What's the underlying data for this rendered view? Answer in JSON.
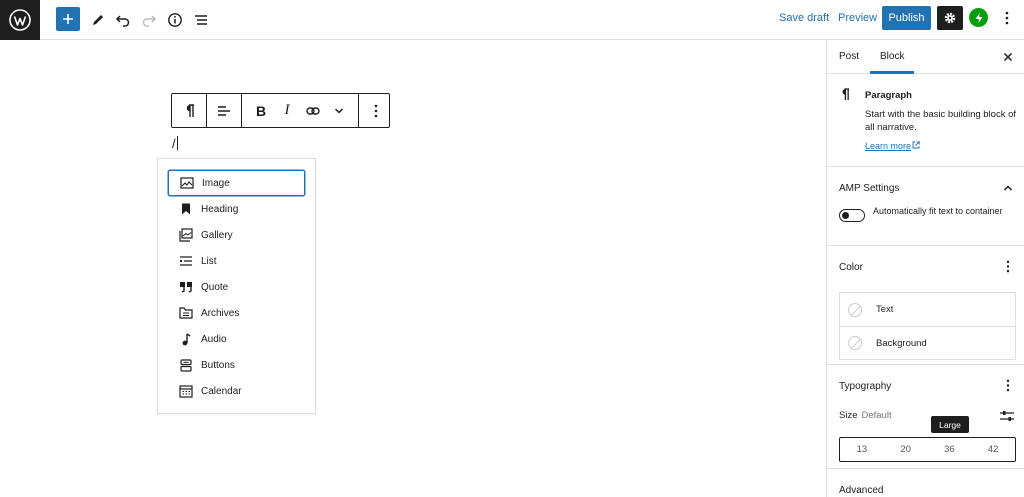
{
  "topbar": {
    "save_draft": "Save draft",
    "preview": "Preview",
    "publish": "Publish"
  },
  "block_toolbar": {
    "bold": "B",
    "italic": "I"
  },
  "editor": {
    "slash_text": "/"
  },
  "inserter_items": [
    {
      "label": "Image",
      "icon": "image-icon"
    },
    {
      "label": "Heading",
      "icon": "bookmark-icon"
    },
    {
      "label": "Gallery",
      "icon": "gallery-icon"
    },
    {
      "label": "List",
      "icon": "list-icon"
    },
    {
      "label": "Quote",
      "icon": "quote-icon"
    },
    {
      "label": "Archives",
      "icon": "archive-icon"
    },
    {
      "label": "Audio",
      "icon": "audio-icon"
    },
    {
      "label": "Buttons",
      "icon": "buttons-icon"
    },
    {
      "label": "Calendar",
      "icon": "calendar-icon"
    }
  ],
  "sidebar": {
    "tabs": [
      "Post",
      "Block"
    ],
    "active_tab": "Block",
    "block_card": {
      "title": "Paragraph",
      "description": "Start with the basic building block of all narrative.",
      "learn_more": "Learn more"
    },
    "amp": {
      "title": "AMP Settings",
      "toggle_label": "Automatically fit text to container"
    },
    "color": {
      "title": "Color",
      "rows": [
        "Text",
        "Background"
      ]
    },
    "typography": {
      "title": "Typography",
      "size_label": "Size",
      "size_value": "Default",
      "tooltip": "Large",
      "sizes": [
        "13",
        "20",
        "36",
        "42"
      ]
    },
    "advanced": {
      "title": "Advanced"
    }
  },
  "colors": {
    "accent": "#2271b1",
    "dark": "#1e1e1e",
    "jetpack": "#069e08"
  }
}
